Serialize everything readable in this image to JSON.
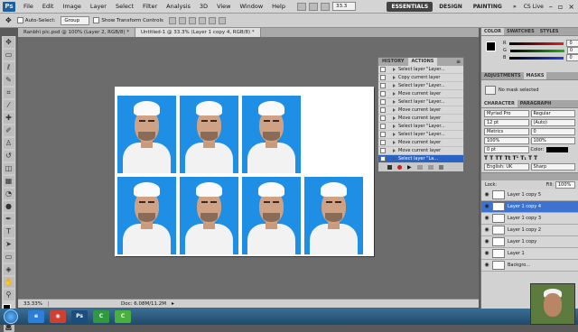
{
  "app": {
    "logo": "Ps"
  },
  "menu": [
    "File",
    "Edit",
    "Image",
    "Layer",
    "Select",
    "Filter",
    "Analysis",
    "3D",
    "View",
    "Window",
    "Help"
  ],
  "zoom": "33.3",
  "workspaces": [
    {
      "label": "ESSENTIALS",
      "active": true
    },
    {
      "label": "DESIGN",
      "active": false
    },
    {
      "label": "PAINTING",
      "active": false
    }
  ],
  "cslive": "CS Live",
  "options": {
    "auto_select_label": "Auto-Select:",
    "auto_select_value": "Group",
    "transform_label": "Show Transform Controls"
  },
  "doc_tabs": [
    {
      "label": "Ranbhi pic.psd @ 100% (Layer 2, RGB/8) *",
      "active": false
    },
    {
      "label": "Untitled-1 @ 33.3% (Layer 1 copy 4, RGB/8) *",
      "active": true
    }
  ],
  "status": {
    "zoom": "33.33%",
    "doc": "Doc: 6.08M/11.2M"
  },
  "history": {
    "tabs": [
      {
        "label": "HISTORY",
        "active": false
      },
      {
        "label": "ACTIONS",
        "active": true
      }
    ],
    "rows": [
      {
        "label": "Select layer \"Layer...",
        "selected": false
      },
      {
        "label": "Copy current layer",
        "selected": false
      },
      {
        "label": "Select layer \"Layer...",
        "selected": false
      },
      {
        "label": "Move current layer",
        "selected": false
      },
      {
        "label": "Select layer \"Layer...",
        "selected": false
      },
      {
        "label": "Move current layer",
        "selected": false
      },
      {
        "label": "Move current layer",
        "selected": false
      },
      {
        "label": "Select layer \"Layer...",
        "selected": false
      },
      {
        "label": "Select layer \"Layer...",
        "selected": false
      },
      {
        "label": "Move current layer",
        "selected": false
      },
      {
        "label": "Move current layer",
        "selected": false
      },
      {
        "label": "Select layer \"La...",
        "selected": true
      }
    ]
  },
  "color_panel": {
    "tabs": [
      {
        "label": "COLOR",
        "active": true
      },
      {
        "label": "SWATCHES",
        "active": false
      },
      {
        "label": "STYLES",
        "active": false
      }
    ],
    "channels": [
      {
        "label": "R",
        "value": "0",
        "color": "#e02020"
      },
      {
        "label": "G",
        "value": "0",
        "color": "#20b020"
      },
      {
        "label": "B",
        "value": "0",
        "color": "#2040e0"
      }
    ]
  },
  "adjust_panel": {
    "tabs": [
      {
        "label": "ADJUSTMENTS",
        "active": false
      },
      {
        "label": "MASKS",
        "active": true
      }
    ],
    "text": "No mask selected"
  },
  "char_panel": {
    "tabs": [
      {
        "label": "CHARACTER",
        "active": true
      },
      {
        "label": "PARAGRAPH",
        "active": false
      }
    ],
    "font_family": "Myriad Pro",
    "font_style": "Regular",
    "size": "12 pt",
    "leading": "(Auto)",
    "kerning": "Metrics",
    "tracking": "0",
    "vscale": "100%",
    "hscale": "100%",
    "baseline": "0 pt",
    "color_label": "Color:",
    "language": "English: UK",
    "aa": "Sharp"
  },
  "layers": {
    "lock_label": "Lock:",
    "fill_label": "Fill:",
    "fill_value": "100%",
    "rows": [
      {
        "label": "Layer 1 copy 5",
        "selected": false
      },
      {
        "label": "Layer 1 copy 4",
        "selected": true
      },
      {
        "label": "Layer 1 copy 3",
        "selected": false
      },
      {
        "label": "Layer 1 copy 2",
        "selected": false
      },
      {
        "label": "Layer 1 copy",
        "selected": false
      },
      {
        "label": "Layer 1",
        "selected": false
      },
      {
        "label": "Backgro...",
        "selected": false
      }
    ]
  },
  "photos_count": 7,
  "taskbar": {
    "icons": [
      {
        "name": "ie-icon",
        "label": "e",
        "color": "#2c7fd8"
      },
      {
        "name": "chrome-icon",
        "label": "◉",
        "color": "#d04030"
      },
      {
        "name": "photoshop-icon",
        "label": "Ps",
        "color": "#1d4d7e"
      },
      {
        "name": "camtasia-icon",
        "label": "C",
        "color": "#2f9a3d"
      },
      {
        "name": "camtasia-recorder-icon",
        "label": "C",
        "color": "#46b13d"
      }
    ]
  }
}
